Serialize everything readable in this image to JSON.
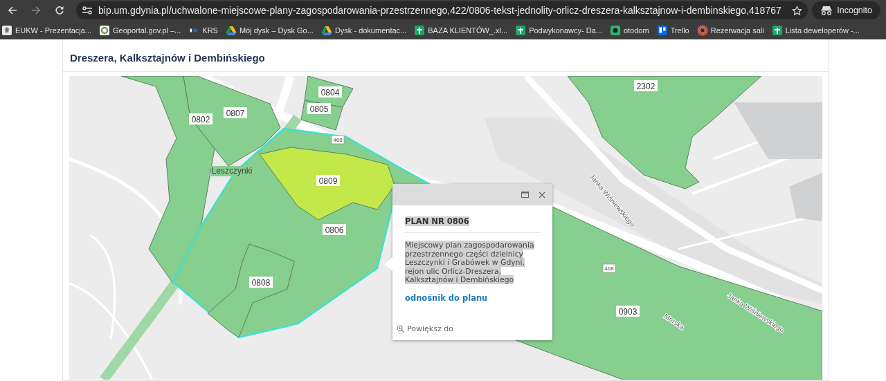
{
  "browser": {
    "url": "bip.um.gdynia.pl/uchwalone-miejscowe-plany-zagospodarowania-przestrzennego,422/0806-tekst-jednolity-orlicz-dreszera-kalksztajnow-i-dembinskiego,418767",
    "profile": "Incognito",
    "bookmarks": [
      {
        "label": "EUKW - Prezentacja...",
        "kind": "emblem"
      },
      {
        "label": "Geoportal.gov.pl –...",
        "kind": "geoportal"
      },
      {
        "label": "KRS",
        "kind": "krs"
      },
      {
        "label": "Mój dysk – Dysk Go...",
        "kind": "drive"
      },
      {
        "label": "Dysk - dokumentac...",
        "kind": "drive"
      },
      {
        "label": "BAZA KLIENTÓW_.xl...",
        "kind": "sheets"
      },
      {
        "label": "Podwykonawcy- Da...",
        "kind": "sheets"
      },
      {
        "label": "otodom",
        "kind": "otodom"
      },
      {
        "label": "Trello",
        "kind": "trello"
      },
      {
        "label": "Rezerwacja sali",
        "kind": "ring"
      },
      {
        "label": "Lista deweloperów -...",
        "kind": "sheets"
      }
    ]
  },
  "page": {
    "heading": "Dreszera, Kalksztajnów i Dembińskiego"
  },
  "map": {
    "regions": [
      {
        "label": "0802",
        "color": "#86cf8f",
        "selected": false
      },
      {
        "label": "0807",
        "color": "#86cf8f",
        "selected": false
      },
      {
        "label": "0804",
        "color": "#86cf8f",
        "selected": false
      },
      {
        "label": "0805",
        "color": "#86cf8f",
        "selected": false
      },
      {
        "label": "2302",
        "color": "#86cf8f",
        "selected": false
      },
      {
        "label": "0806",
        "color": "#86cf8f",
        "selected": true
      },
      {
        "label": "0809",
        "color": "#c2e84a",
        "selected": false
      },
      {
        "label": "0808",
        "color": "#86cf8f",
        "selected": false
      },
      {
        "label": "0903",
        "color": "#86cf8f",
        "selected": false
      }
    ],
    "place_labels": [
      {
        "text": "Leszczynki",
        "kind": "district"
      },
      {
        "text": "Janka Wiśniewskiego",
        "kind": "street"
      },
      {
        "text": "Janka Wiśniewskiego",
        "kind": "street"
      },
      {
        "text": "Morska",
        "kind": "street"
      },
      {
        "text": "468",
        "kind": "shield"
      },
      {
        "text": "468",
        "kind": "shield"
      }
    ],
    "popup": {
      "title": "PLAN NR 0806",
      "description": "Miejscowy plan zagospodarowania przestrzennego części dzielnicy Leszczynki i Grabówek w Gdyni, rejon ulic Orlicz-Dreszera, Kalksztajnów i Dembińskiego",
      "link": "odnośnik do planu",
      "zoom_action": "Powiększ do"
    }
  }
}
